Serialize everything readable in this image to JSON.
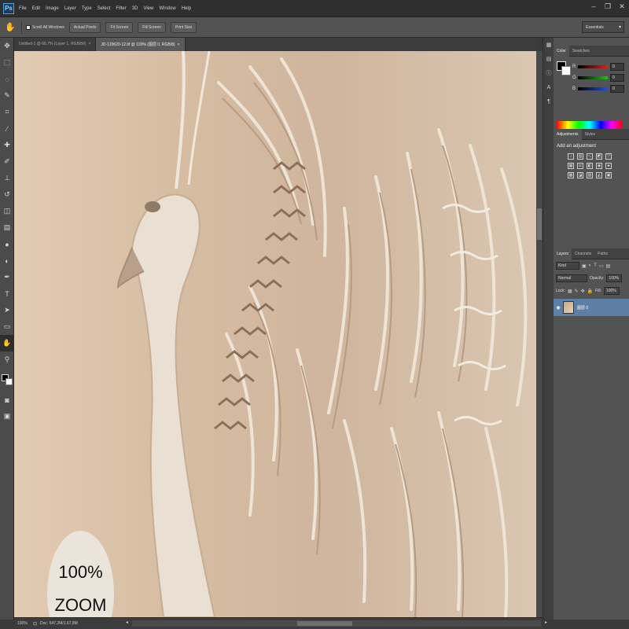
{
  "app": {
    "logo": "Ps"
  },
  "menu": [
    "File",
    "Edit",
    "Image",
    "Layer",
    "Type",
    "Select",
    "Filter",
    "3D",
    "View",
    "Window",
    "Help"
  ],
  "window_controls": {
    "minimize": "–",
    "restore": "❐",
    "close": "✕"
  },
  "options_bar": {
    "tool_icon": "hand-icon",
    "scroll_all_windows": "Scroll All Windows",
    "buttons": [
      "Actual Pixels",
      "Fit Screen",
      "Fill Screen",
      "Print Size"
    ],
    "workspace": "Essentials"
  },
  "document_tabs": [
    {
      "label": "Untitled-1 @ 66.7% (Layer 1, RGB/8#)",
      "active": false
    },
    {
      "label": "JD-120620-12.tif @ 100% (图层 0, RGB/8)",
      "active": true
    }
  ],
  "zoom_badge": {
    "line1": "100%",
    "line2": "ZOOM"
  },
  "color_panel": {
    "tabs": [
      "Color",
      "Swatches"
    ],
    "channels": [
      {
        "label": "R",
        "value": "0",
        "color": "#e02020"
      },
      {
        "label": "G",
        "value": "0",
        "color": "#20c020"
      },
      {
        "label": "B",
        "value": "0",
        "color": "#2050e0"
      }
    ]
  },
  "adjustments_panel": {
    "tabs": [
      "Adjustments",
      "Styles"
    ],
    "title": "Add an adjustment"
  },
  "layers_panel": {
    "tabs": [
      "Layers",
      "Channels",
      "Paths"
    ],
    "kind_filter": "Kind",
    "blend_mode": "Normal",
    "opacity_label": "Opacity:",
    "opacity_value": "100%",
    "lock_label": "Lock:",
    "fill_label": "Fill:",
    "fill_value": "100%",
    "layer_name": "图层 0"
  },
  "status_bar": {
    "zoom": "100%",
    "doc": "Doc: 647.2M/1.67.8M"
  }
}
